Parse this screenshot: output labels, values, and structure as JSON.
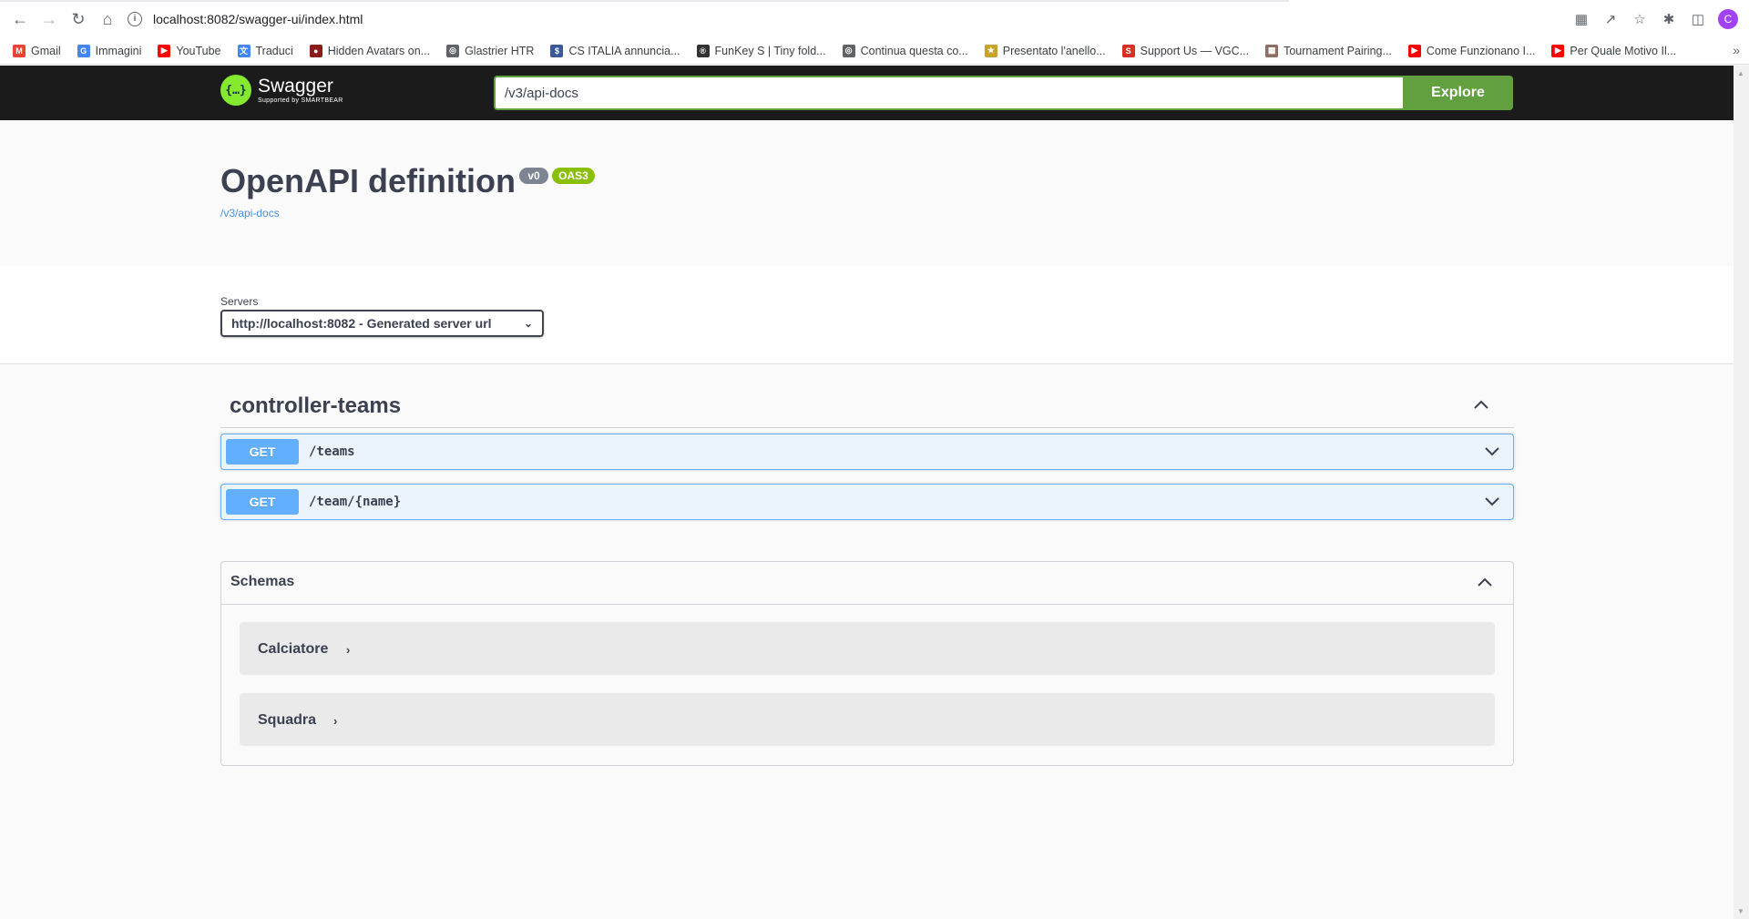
{
  "browser": {
    "url": "localhost:8082/swagger-ui/index.html",
    "avatar_letter": "C",
    "bookmarks": [
      {
        "label": "Gmail",
        "icon": "gmail-icon",
        "color": "#ea4335",
        "glyph": "M"
      },
      {
        "label": "Immagini",
        "icon": "google-icon",
        "color": "#4285f4",
        "glyph": "G"
      },
      {
        "label": "YouTube",
        "icon": "youtube-icon",
        "color": "#ff0000",
        "glyph": "▶"
      },
      {
        "label": "Traduci",
        "icon": "translate-icon",
        "color": "#4285f4",
        "glyph": "文"
      },
      {
        "label": "Hidden Avatars on...",
        "icon": "avatar-site-icon",
        "color": "#8b1a1a",
        "glyph": "●"
      },
      {
        "label": "Glastrier HTR",
        "icon": "globe-icon",
        "color": "#5f6368",
        "glyph": "◎"
      },
      {
        "label": "CS ITALIA annuncia...",
        "icon": "cs-icon",
        "color": "#3b5998",
        "glyph": "$"
      },
      {
        "label": "FunKey S | Tiny fold...",
        "icon": "funkey-icon",
        "color": "#333333",
        "glyph": "®"
      },
      {
        "label": "Continua questa co...",
        "icon": "globe-icon",
        "color": "#5f6368",
        "glyph": "◎"
      },
      {
        "label": "Presentato l'anello...",
        "icon": "news-icon",
        "color": "#c9a227",
        "glyph": "★"
      },
      {
        "label": "Support Us — VGC...",
        "icon": "vgc-icon",
        "color": "#d93025",
        "glyph": "S"
      },
      {
        "label": "Tournament Pairing...",
        "icon": "tournament-icon",
        "color": "#8d6e63",
        "glyph": "▦"
      },
      {
        "label": "Come Funzionano I...",
        "icon": "youtube-icon",
        "color": "#ff0000",
        "glyph": "▶"
      },
      {
        "label": "Per Quale Motivo Il...",
        "icon": "youtube-icon",
        "color": "#ff0000",
        "glyph": "▶"
      }
    ]
  },
  "topbar": {
    "logo_title": "Swagger",
    "logo_sub": "Supported by SMARTBEAR",
    "search_value": "/v3/api-docs",
    "explore_label": "Explore"
  },
  "info": {
    "title": "OpenAPI definition",
    "version_badge": "v0",
    "oas_badge": "OAS3",
    "url_link": "/v3/api-docs"
  },
  "servers": {
    "label": "Servers",
    "selected": "http://localhost:8082 - Generated server url"
  },
  "tag": {
    "name": "controller-teams",
    "operations": [
      {
        "method": "GET",
        "path": "/teams"
      },
      {
        "method": "GET",
        "path": "/team/{name}"
      }
    ]
  },
  "schemas": {
    "title": "Schemas",
    "models": [
      {
        "name": "Calciatore"
      },
      {
        "name": "Squadra"
      }
    ]
  },
  "colors": {
    "get_method": "#61affe",
    "explore_green": "#62a03f",
    "topbar_bg": "#1b1b1b",
    "badge_gray": "#7d8492",
    "badge_green": "#89bf04"
  }
}
